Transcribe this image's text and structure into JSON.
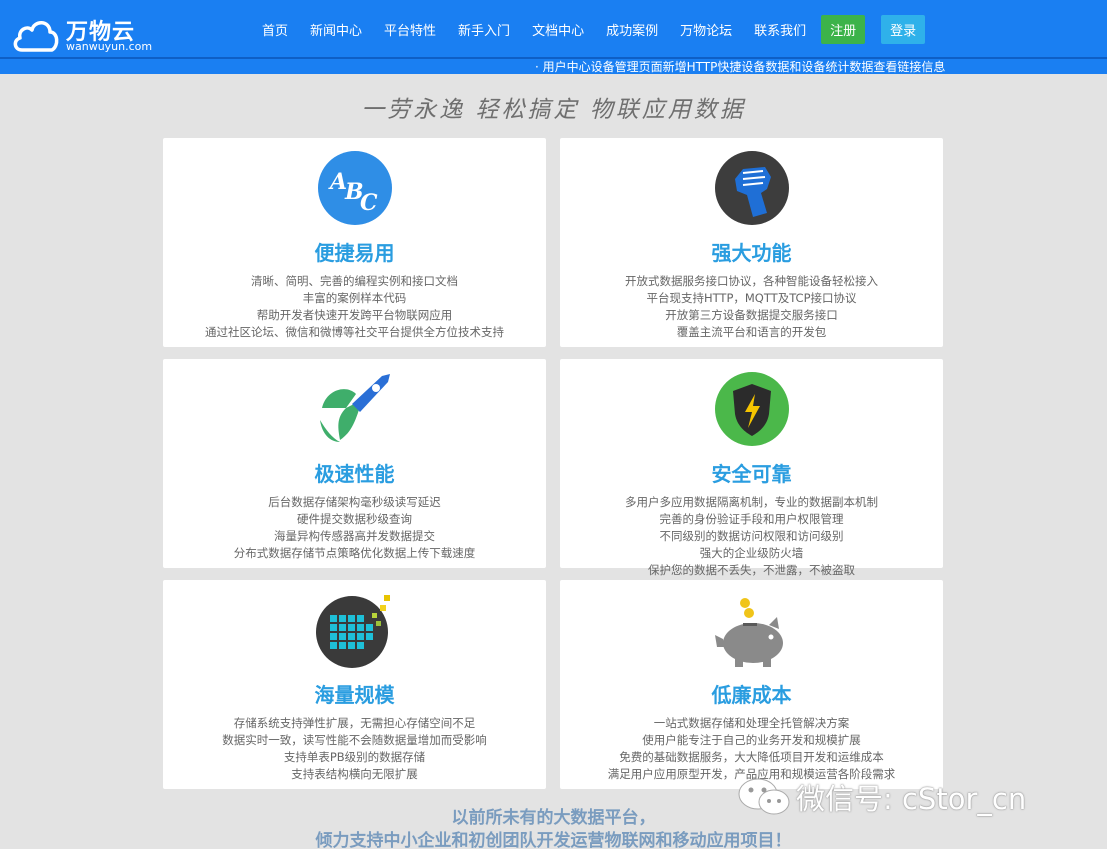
{
  "header": {
    "logo_name": "万物云",
    "logo_sub": "wanwuyun.com",
    "nav": [
      "首页",
      "新闻中心",
      "平台特性",
      "新手入门",
      "文档中心",
      "成功案例",
      "万物论坛",
      "联系我们"
    ],
    "register_label": "注册",
    "login_label": "登录",
    "brand_color": "#1a7ff2"
  },
  "ticker": {
    "text": "· 用户中心设备管理页面新增HTTP快捷设备数据和设备统计数据查看链接信息"
  },
  "slogan": "一劳永逸  轻松搞定  物联应用数据",
  "features": [
    {
      "icon": "abc-icon",
      "title": "便捷易用",
      "lines": [
        "清晰、简明、完善的编程实例和接口文档",
        "丰富的案例样本代码",
        "帮助开发者快速开发跨平台物联网应用",
        "通过社区论坛、微信和微博等社交平台提供全方位技术支持"
      ]
    },
    {
      "icon": "fist-icon",
      "title": "强大功能",
      "lines": [
        "开放式数据服务接口协议，各种智能设备轻松接入",
        "平台现支持HTTP，MQTT及TCP接口协议",
        "开放第三方设备数据提交服务接口",
        "覆盖主流平台和语言的开发包"
      ]
    },
    {
      "icon": "rocket-icon",
      "title": "极速性能",
      "lines": [
        "后台数据存储架构毫秒级读写延迟",
        "硬件提交数据秒级查询",
        "海量异构传感器高并发数据提交",
        "分布式数据存储节点策略优化数据上传下载速度"
      ]
    },
    {
      "icon": "shield-icon",
      "title": "安全可靠",
      "lines": [
        "多用户多应用数据隔离机制，专业的数据副本机制",
        "完善的身份验证手段和用户权限管理",
        "不同级别的数据访问权限和访问级别",
        "强大的企业级防火墙",
        "保护您的数据不丢失，不泄露，不被盗取"
      ]
    },
    {
      "icon": "grid-blocks-icon",
      "title": "海量规模",
      "lines": [
        "存储系统支持弹性扩展，无需担心存储空间不足",
        "数据实时一致，读写性能不会随数据量增加而受影响",
        "支持单表PB级别的数据存储",
        "支持表结构横向无限扩展"
      ]
    },
    {
      "icon": "piggy-bank-icon",
      "title": "低廉成本",
      "lines": [
        "一站式数据存储和处理全托管解决方案",
        "使用户能专注于自己的业务开发和规模扩展",
        "免费的基础数据服务，大大降低项目开发和运维成本",
        "满足用户应用原型开发，产品应用和规模运营各阶段需求"
      ]
    }
  ],
  "footer": {
    "line1": "以前所未有的大数据平台，",
    "line2": "倾力支持中小企业和初创团队开发运营物联网和移动应用项目！"
  },
  "watermark": {
    "text": "微信号: cStor_cn"
  }
}
